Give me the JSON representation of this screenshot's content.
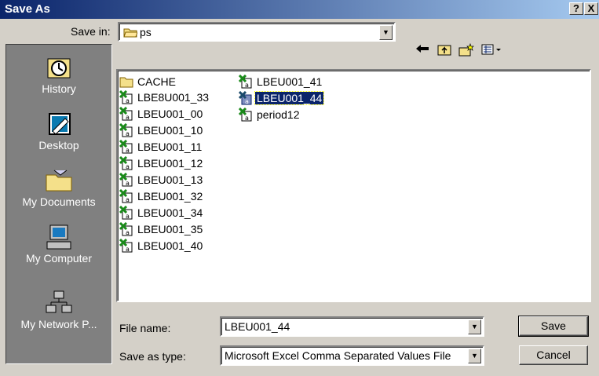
{
  "title": "Save As",
  "title_buttons": {
    "help": "?",
    "close": "X"
  },
  "save_in": {
    "label": "Save in:",
    "value": "ps"
  },
  "places": [
    {
      "label": "History",
      "icon": "history-icon"
    },
    {
      "label": "Desktop",
      "icon": "desktop-icon"
    },
    {
      "label": "My Documents",
      "icon": "my-documents-icon"
    },
    {
      "label": "My Computer",
      "icon": "my-computer-icon"
    },
    {
      "label": "My Network P...",
      "icon": "my-network-places-icon"
    }
  ],
  "files": [
    {
      "name": "CACHE",
      "type": "folder"
    },
    {
      "name": "LBE8U001_33",
      "type": "csv"
    },
    {
      "name": "LBEU001_00",
      "type": "csv"
    },
    {
      "name": "LBEU001_10",
      "type": "csv"
    },
    {
      "name": "LBEU001_11",
      "type": "csv"
    },
    {
      "name": "LBEU001_12",
      "type": "csv"
    },
    {
      "name": "LBEU001_13",
      "type": "csv"
    },
    {
      "name": "LBEU001_32",
      "type": "csv"
    },
    {
      "name": "LBEU001_34",
      "type": "csv"
    },
    {
      "name": "LBEU001_35",
      "type": "csv"
    },
    {
      "name": "LBEU001_40",
      "type": "csv"
    },
    {
      "name": "LBEU001_41",
      "type": "csv"
    },
    {
      "name": "LBEU001_44",
      "type": "csv",
      "selected": true
    },
    {
      "name": "period12",
      "type": "csv"
    }
  ],
  "file_name": {
    "label": "File name:",
    "value": "LBEU001_44"
  },
  "save_as_type": {
    "label": "Save as type:",
    "value": "Microsoft Excel Comma Separated Values File"
  },
  "buttons": {
    "save": "Save",
    "cancel": "Cancel"
  }
}
